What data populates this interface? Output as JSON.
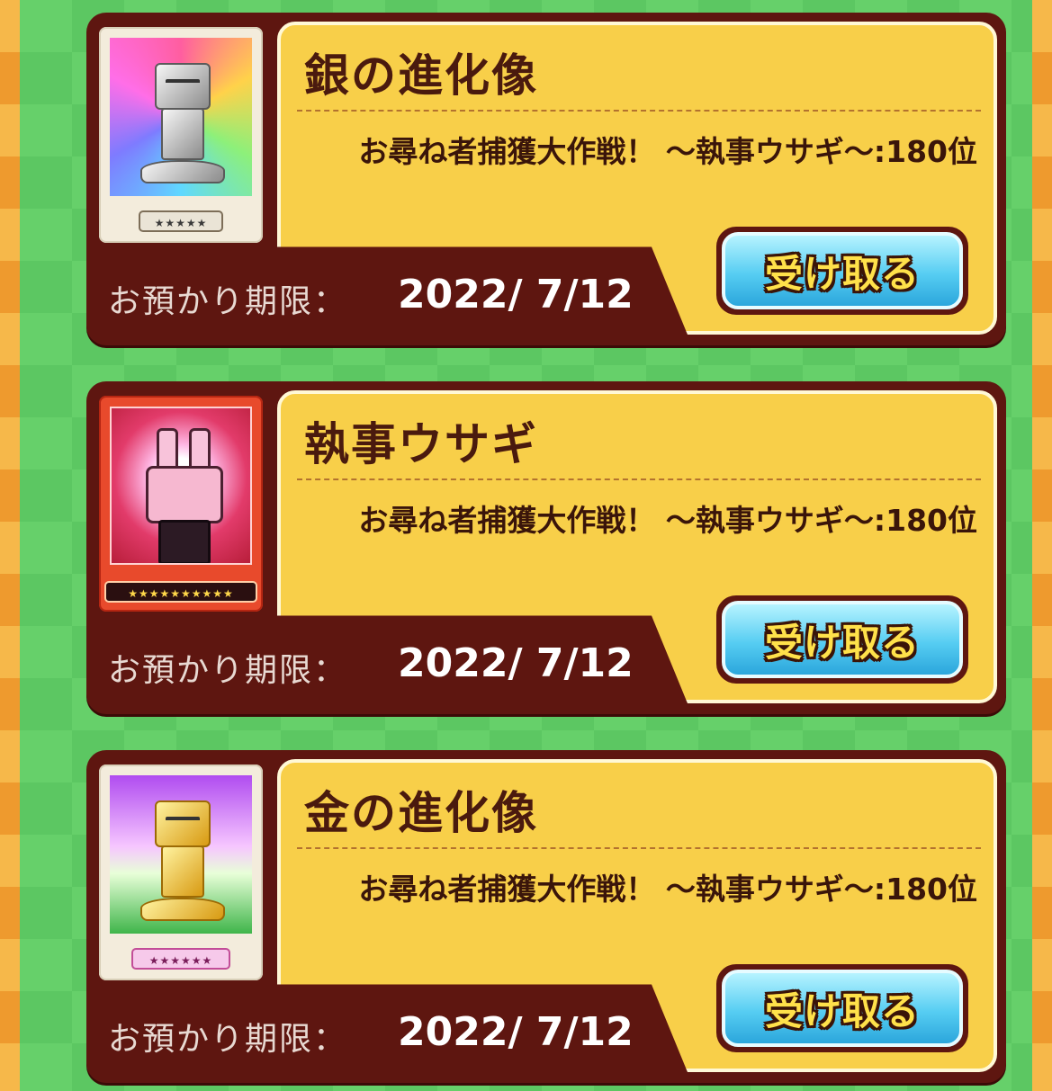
{
  "gifts": [
    {
      "title": "銀の進化像",
      "source": "お尋ね者捕獲大作戦！ ～執事ウサギ～:180位",
      "expire_label": "お預かり期限：",
      "expire_date": "2022/ 7/12",
      "rarity": "★★★★★",
      "button_label": "受け取る",
      "icon": "silver-evolution-statue-icon"
    },
    {
      "title": "執事ウサギ",
      "source": "お尋ね者捕獲大作戦！ ～執事ウサギ～:180位",
      "expire_label": "お預かり期限：",
      "expire_date": "2022/ 7/12",
      "rarity": "★★★★★★★★★★",
      "button_label": "受け取る",
      "icon": "butler-rabbit-icon"
    },
    {
      "title": "金の進化像",
      "source": "お尋ね者捕獲大作戦！ ～執事ウサギ～:180位",
      "expire_label": "お預かり期限：",
      "expire_date": "2022/ 7/12",
      "rarity": "★★★★★★",
      "button_label": "受け取る",
      "icon": "gold-evolution-statue-icon"
    }
  ],
  "colors": {
    "card": "#5e1610",
    "panel": "#f8cf49",
    "button": "#56cdf2",
    "background_green": "#66d06a",
    "edge_orange": "#f2a238"
  }
}
